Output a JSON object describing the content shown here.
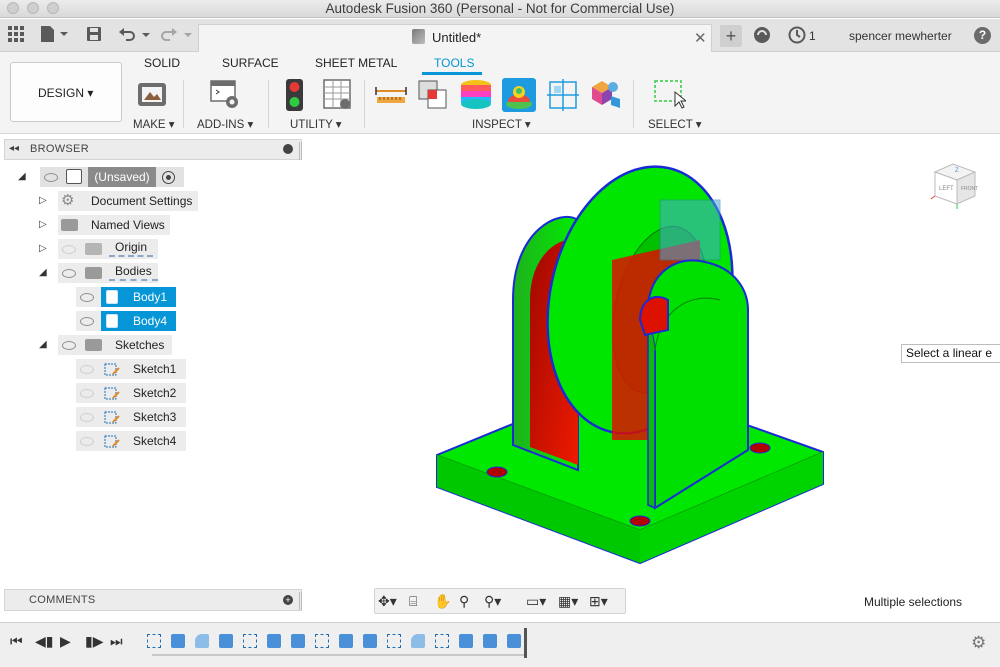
{
  "window": {
    "title": "Autodesk Fusion 360 (Personal - Not for Commercial Use)"
  },
  "app_toolbar": {
    "document_tab_title": "Untitled*",
    "job_count": "1",
    "user_name": "spencer mewherter",
    "help": "?"
  },
  "ribbon": {
    "workspace": "DESIGN",
    "tabs": [
      {
        "label": "SOLID",
        "active": false
      },
      {
        "label": "SURFACE",
        "active": false
      },
      {
        "label": "SHEET METAL",
        "active": false
      },
      {
        "label": "TOOLS",
        "active": true
      }
    ],
    "groups": [
      {
        "label": "MAKE"
      },
      {
        "label": "ADD-INS"
      },
      {
        "label": "UTILITY"
      },
      {
        "label": "INSPECT"
      },
      {
        "label": "SELECT"
      }
    ],
    "accent_color": "#0696d7"
  },
  "browser": {
    "title": "BROWSER",
    "root": {
      "label": "(Unsaved)"
    },
    "items": [
      {
        "label": "Document Settings",
        "icon": "gear-icon"
      },
      {
        "label": "Named Views",
        "icon": "folder-icon"
      },
      {
        "label": "Origin",
        "icon": "folder-icon",
        "hidden": true
      },
      {
        "label": "Bodies",
        "icon": "folder-icon"
      },
      {
        "label": "Body1",
        "icon": "body-icon",
        "selected": true
      },
      {
        "label": "Body4",
        "icon": "body-icon",
        "selected": true
      },
      {
        "label": "Sketches",
        "icon": "folder-icon"
      },
      {
        "label": "Sketch1",
        "icon": "sketch-icon",
        "hidden": true
      },
      {
        "label": "Sketch2",
        "icon": "sketch-icon",
        "hidden": true
      },
      {
        "label": "Sketch3",
        "icon": "sketch-icon",
        "hidden": true
      },
      {
        "label": "Sketch4",
        "icon": "sketch-icon",
        "hidden": true
      }
    ]
  },
  "comments": {
    "title": "COMMENTS"
  },
  "viewport": {
    "tooltip": "Select a linear e",
    "status": "Multiple selections",
    "view_cube_labels": [
      "LEFT",
      "FRONT",
      "Z"
    ],
    "body_color": "#00ee00",
    "interference_color": "#dd1100",
    "edge_color": "#1a2bd6"
  }
}
